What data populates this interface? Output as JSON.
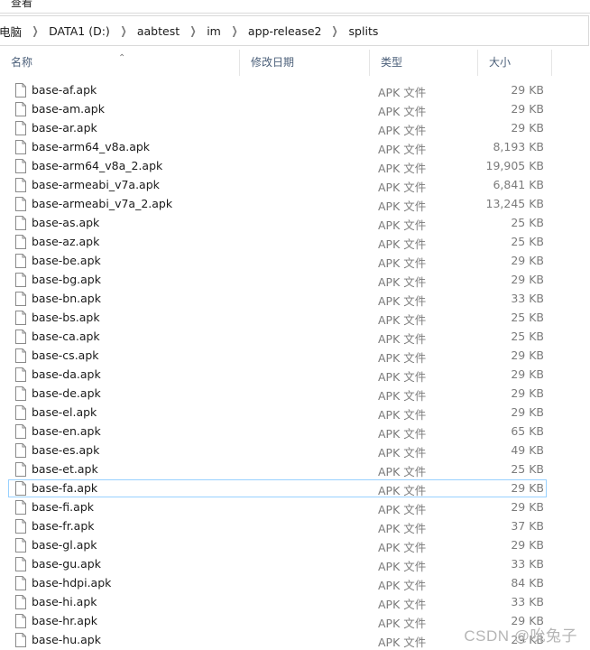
{
  "menu": {
    "label": "查看"
  },
  "breadcrumb": [
    "电脑",
    "DATA1 (D:)",
    "aabtest",
    "im",
    "app-release2",
    "splits"
  ],
  "columns": {
    "name": "名称",
    "date": "修改日期",
    "type": "类型",
    "size": "大小"
  },
  "focused_file": "base-fa.apk",
  "files": [
    {
      "name": "base-af.apk",
      "type": "APK 文件",
      "size": "29 KB"
    },
    {
      "name": "base-am.apk",
      "type": "APK 文件",
      "size": "29 KB"
    },
    {
      "name": "base-ar.apk",
      "type": "APK 文件",
      "size": "29 KB"
    },
    {
      "name": "base-arm64_v8a.apk",
      "type": "APK 文件",
      "size": "8,193 KB"
    },
    {
      "name": "base-arm64_v8a_2.apk",
      "type": "APK 文件",
      "size": "19,905 KB"
    },
    {
      "name": "base-armeabi_v7a.apk",
      "type": "APK 文件",
      "size": "6,841 KB"
    },
    {
      "name": "base-armeabi_v7a_2.apk",
      "type": "APK 文件",
      "size": "13,245 KB"
    },
    {
      "name": "base-as.apk",
      "type": "APK 文件",
      "size": "25 KB"
    },
    {
      "name": "base-az.apk",
      "type": "APK 文件",
      "size": "25 KB"
    },
    {
      "name": "base-be.apk",
      "type": "APK 文件",
      "size": "29 KB"
    },
    {
      "name": "base-bg.apk",
      "type": "APK 文件",
      "size": "29 KB"
    },
    {
      "name": "base-bn.apk",
      "type": "APK 文件",
      "size": "33 KB"
    },
    {
      "name": "base-bs.apk",
      "type": "APK 文件",
      "size": "25 KB"
    },
    {
      "name": "base-ca.apk",
      "type": "APK 文件",
      "size": "25 KB"
    },
    {
      "name": "base-cs.apk",
      "type": "APK 文件",
      "size": "29 KB"
    },
    {
      "name": "base-da.apk",
      "type": "APK 文件",
      "size": "29 KB"
    },
    {
      "name": "base-de.apk",
      "type": "APK 文件",
      "size": "29 KB"
    },
    {
      "name": "base-el.apk",
      "type": "APK 文件",
      "size": "29 KB"
    },
    {
      "name": "base-en.apk",
      "type": "APK 文件",
      "size": "65 KB"
    },
    {
      "name": "base-es.apk",
      "type": "APK 文件",
      "size": "49 KB"
    },
    {
      "name": "base-et.apk",
      "type": "APK 文件",
      "size": "25 KB"
    },
    {
      "name": "base-fa.apk",
      "type": "APK 文件",
      "size": "29 KB"
    },
    {
      "name": "base-fi.apk",
      "type": "APK 文件",
      "size": "29 KB"
    },
    {
      "name": "base-fr.apk",
      "type": "APK 文件",
      "size": "37 KB"
    },
    {
      "name": "base-gl.apk",
      "type": "APK 文件",
      "size": "29 KB"
    },
    {
      "name": "base-gu.apk",
      "type": "APK 文件",
      "size": "33 KB"
    },
    {
      "name": "base-hdpi.apk",
      "type": "APK 文件",
      "size": "84 KB"
    },
    {
      "name": "base-hi.apk",
      "type": "APK 文件",
      "size": "33 KB"
    },
    {
      "name": "base-hr.apk",
      "type": "APK 文件",
      "size": "29 KB"
    },
    {
      "name": "base-hu.apk",
      "type": "APK 文件",
      "size": "29 KB"
    }
  ],
  "watermark": "CSDN @吮兔子",
  "colors": {
    "focus_border": "#99d1ff",
    "header_text": "#4c607a",
    "muted_text": "#7b7b7b"
  }
}
